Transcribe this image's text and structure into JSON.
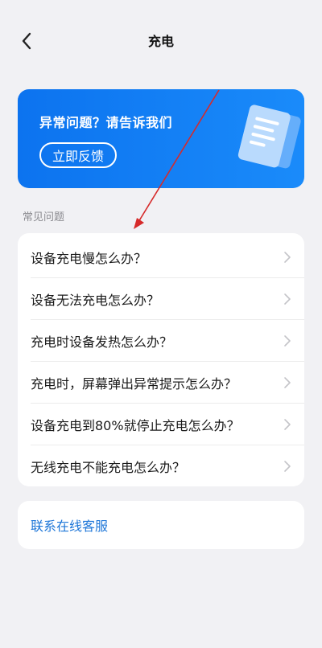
{
  "header": {
    "title": "充电",
    "back_icon": "chevron-left-icon"
  },
  "banner": {
    "title": "异常问题？请告诉我们",
    "button_label": "立即反馈",
    "illustration_icon": "document-icon",
    "colors": {
      "start": "#0c73ef",
      "end": "#1a8bfa"
    }
  },
  "faq": {
    "section_label": "常见问题",
    "items": [
      {
        "label": "设备充电慢怎么办？"
      },
      {
        "label": "设备无法充电怎么办？"
      },
      {
        "label": "充电时设备发热怎么办？"
      },
      {
        "label": "充电时，屏幕弹出异常提示怎么办？"
      },
      {
        "label": "设备充电到80%就停止充电怎么办？"
      },
      {
        "label": "无线充电不能充电怎么办？"
      }
    ],
    "chevron_icon": "chevron-right-icon"
  },
  "contact": {
    "label": "联系在线客服",
    "color": "#1d76d8"
  },
  "annotation": {
    "color": "#d62a2a"
  }
}
